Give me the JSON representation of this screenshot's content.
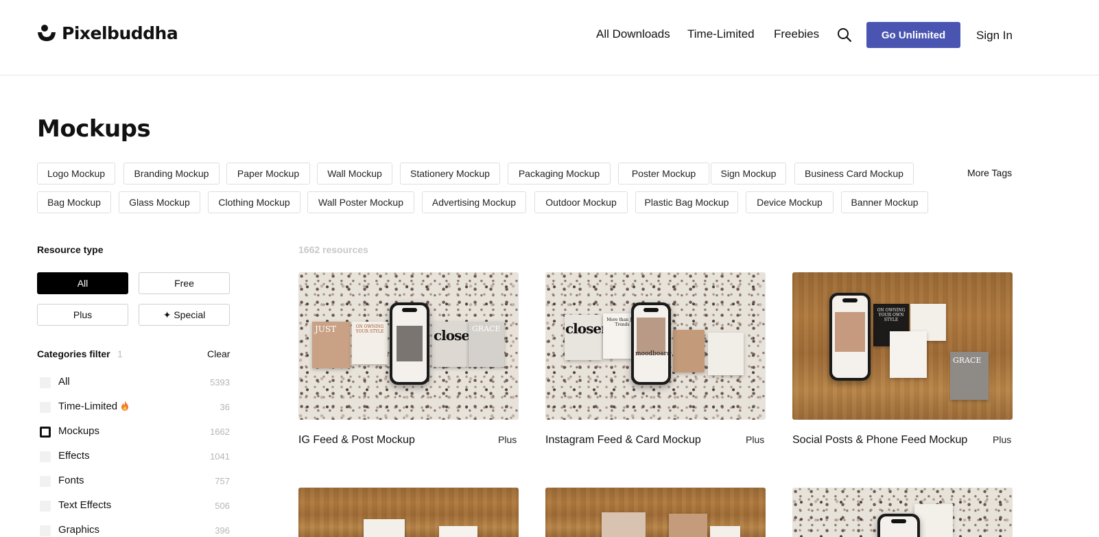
{
  "header": {
    "logo_text": "Pixelbuddha",
    "nav": [
      {
        "label": "All Downloads"
      },
      {
        "label": "Time-Limited"
      },
      {
        "label": "Freebies"
      }
    ],
    "cta_label": "Go Unlimited",
    "signin_label": "Sign In"
  },
  "page": {
    "title": "Mockups",
    "more_tags": "More Tags"
  },
  "tags": [
    "Logo Mockup",
    "Branding Mockup",
    "Paper Mockup",
    "Wall Mockup",
    "Stationery Mockup",
    "Packaging Mockup",
    "Poster Mockup",
    "Sign Mockup",
    "Business Card Mockup",
    "Bag Mockup",
    "Glass Mockup",
    "Clothing Mockup",
    "Wall Poster Mockup",
    "Advertising Mockup",
    "Outdoor Mockup",
    "Plastic Bag Mockup",
    "Device Mockup",
    "Banner Mockup"
  ],
  "sidebar": {
    "resource_type_label": "Resource type",
    "resource_types": [
      {
        "label": "All",
        "active": true
      },
      {
        "label": "Free",
        "active": false
      },
      {
        "label": "Plus",
        "active": false
      },
      {
        "label": "✦ Special",
        "active": false
      }
    ],
    "categories_label": "Categories filter",
    "categories_selected_count": "1",
    "clear_label": "Clear",
    "categories": [
      {
        "name": "All",
        "count": "5393",
        "checked": false
      },
      {
        "name": "Time-Limited",
        "count": "36",
        "checked": false,
        "icon": "fire-icon"
      },
      {
        "name": "Mockups",
        "count": "1662",
        "checked": true
      },
      {
        "name": "Effects",
        "count": "1041",
        "checked": false
      },
      {
        "name": "Fonts",
        "count": "757",
        "checked": false
      },
      {
        "name": "Text Effects",
        "count": "506",
        "checked": false
      },
      {
        "name": "Graphics",
        "count": "396",
        "checked": false
      }
    ]
  },
  "results": {
    "count_label": "1662 resources",
    "cards": [
      {
        "title": "IG Feed & Post Mockup",
        "tier": "Plus",
        "art": {
          "just": "JUST",
          "own": "ON OWNING YOUR STYLE",
          "closer": "closer",
          "grace": "GRACE"
        }
      },
      {
        "title": "Instagram Feed & Card Mockup",
        "tier": "Plus",
        "art": {
          "closer": "closer",
          "more": "More than Just Trends",
          "moods": "moodboards"
        }
      },
      {
        "title": "Social Posts & Phone Feed Mockup",
        "tier": "Plus",
        "art": {
          "own": "ON OWNING YOUR OWN STYLE",
          "grace": "GRACE"
        }
      }
    ]
  },
  "colors": {
    "accent": "#4a55b2",
    "active_filter": "#000000",
    "muted_count": "#b5b5b5"
  }
}
